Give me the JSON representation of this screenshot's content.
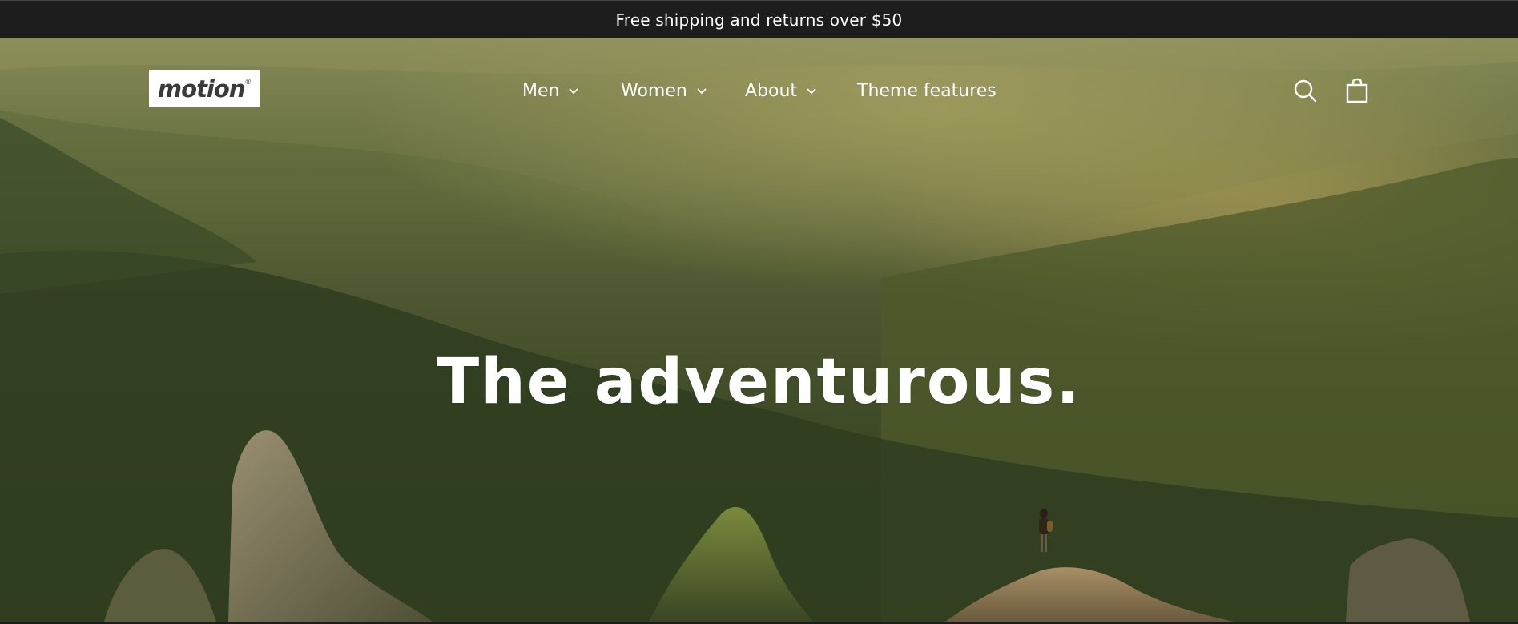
{
  "announcement": {
    "text": "Free shipping and returns over $50"
  },
  "header": {
    "logo_text": "motion",
    "logo_mark": "®",
    "nav": [
      {
        "label": "Men",
        "has_dropdown": true
      },
      {
        "label": "Women",
        "has_dropdown": true
      },
      {
        "label": "About",
        "has_dropdown": true
      },
      {
        "label": "Theme features",
        "has_dropdown": false
      }
    ],
    "icons": {
      "search": "search-icon",
      "cart": "shopping-bag-icon",
      "dropdown": "chevron-down-icon"
    }
  },
  "hero": {
    "headline": "The adventurous.",
    "background": "mountain-landscape-photo"
  },
  "colors": {
    "announcement_bg": "#1c1d1c",
    "text_light": "#ffffff",
    "logo_bg": "#ffffff",
    "logo_text": "#3a3a3a"
  }
}
